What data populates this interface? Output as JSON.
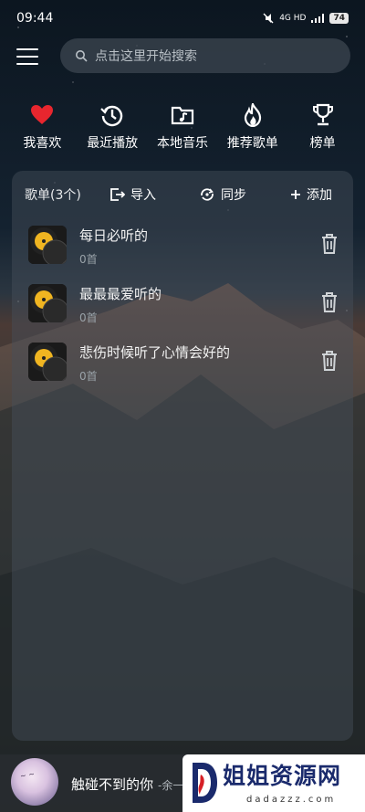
{
  "status": {
    "time": "09:44",
    "network": "4G HD",
    "battery": "74"
  },
  "search": {
    "placeholder": "点击这里开始搜索"
  },
  "quick_actions": [
    {
      "label": "我喜欢",
      "icon": "heart-icon"
    },
    {
      "label": "最近播放",
      "icon": "history-icon"
    },
    {
      "label": "本地音乐",
      "icon": "music-folder-icon"
    },
    {
      "label": "推荐歌单",
      "icon": "flame-icon"
    },
    {
      "label": "榜单",
      "icon": "trophy-icon"
    }
  ],
  "panel": {
    "count_label": "歌单(3个)",
    "import_label": "导入",
    "sync_label": "同步",
    "add_label": "添加"
  },
  "playlists": [
    {
      "title": "每日必听的",
      "count": "0首"
    },
    {
      "title": "最最最爱听的",
      "count": "0首"
    },
    {
      "title": "悲伤时候听了心情会好的",
      "count": "0首"
    }
  ],
  "player": {
    "title": "触碰不到的你",
    "artist": "-余一"
  },
  "watermark": {
    "text": "姐姐资源网",
    "url": "dadazzz.com"
  },
  "colors": {
    "accent_heart": "#e8262e",
    "watermark_blue": "#1a2a6c",
    "watermark_red": "#d61f26"
  }
}
